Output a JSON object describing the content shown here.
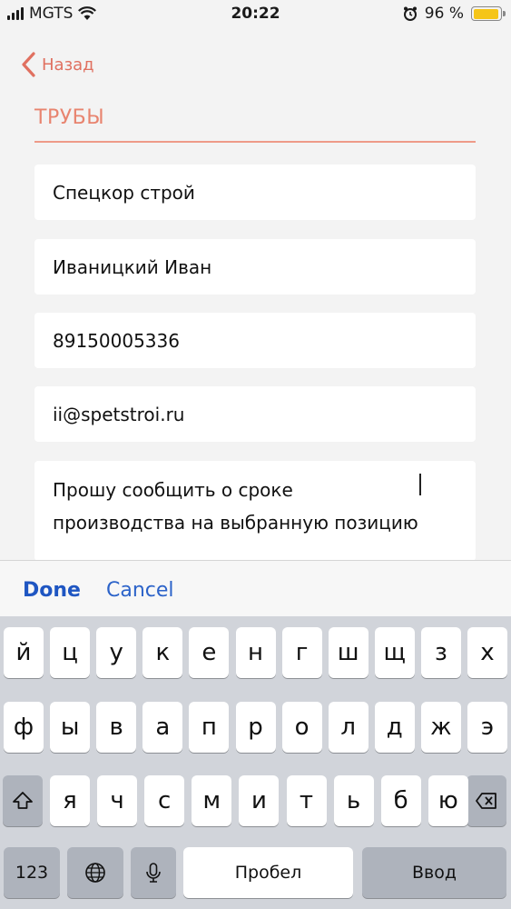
{
  "status_bar": {
    "carrier": "MGTS",
    "time": "20:22",
    "battery": "96 %",
    "battery_level": 0.96
  },
  "nav": {
    "back_label": "Назад"
  },
  "page": {
    "title": "ТРУБЫ"
  },
  "form": {
    "company": "Спецкор строй",
    "name": "Иваницкий Иван",
    "phone": "89150005336",
    "email": "ii@spetstroi.ru",
    "message": "Прошу сообщить о сроке\nпроизводства на выбранную позицию"
  },
  "accessory": {
    "done_label": "Done",
    "cancel_label": "Cancel"
  },
  "keyboard": {
    "row1": [
      "й",
      "ц",
      "у",
      "к",
      "е",
      "н",
      "г",
      "ш",
      "щ",
      "з",
      "х"
    ],
    "row2": [
      "ф",
      "ы",
      "в",
      "а",
      "п",
      "р",
      "о",
      "л",
      "д",
      "ж",
      "э"
    ],
    "row3": [
      "я",
      "ч",
      "с",
      "м",
      "и",
      "т",
      "ь",
      "б",
      "ю"
    ],
    "numbers_label": "123",
    "space_label": "Пробел",
    "return_label": "Ввод"
  },
  "icons": [
    "signal-icon",
    "wifi-icon",
    "alarm-icon",
    "battery-icon",
    "chevron-left-icon",
    "shift-icon",
    "backspace-icon",
    "globe-icon",
    "microphone-icon"
  ]
}
